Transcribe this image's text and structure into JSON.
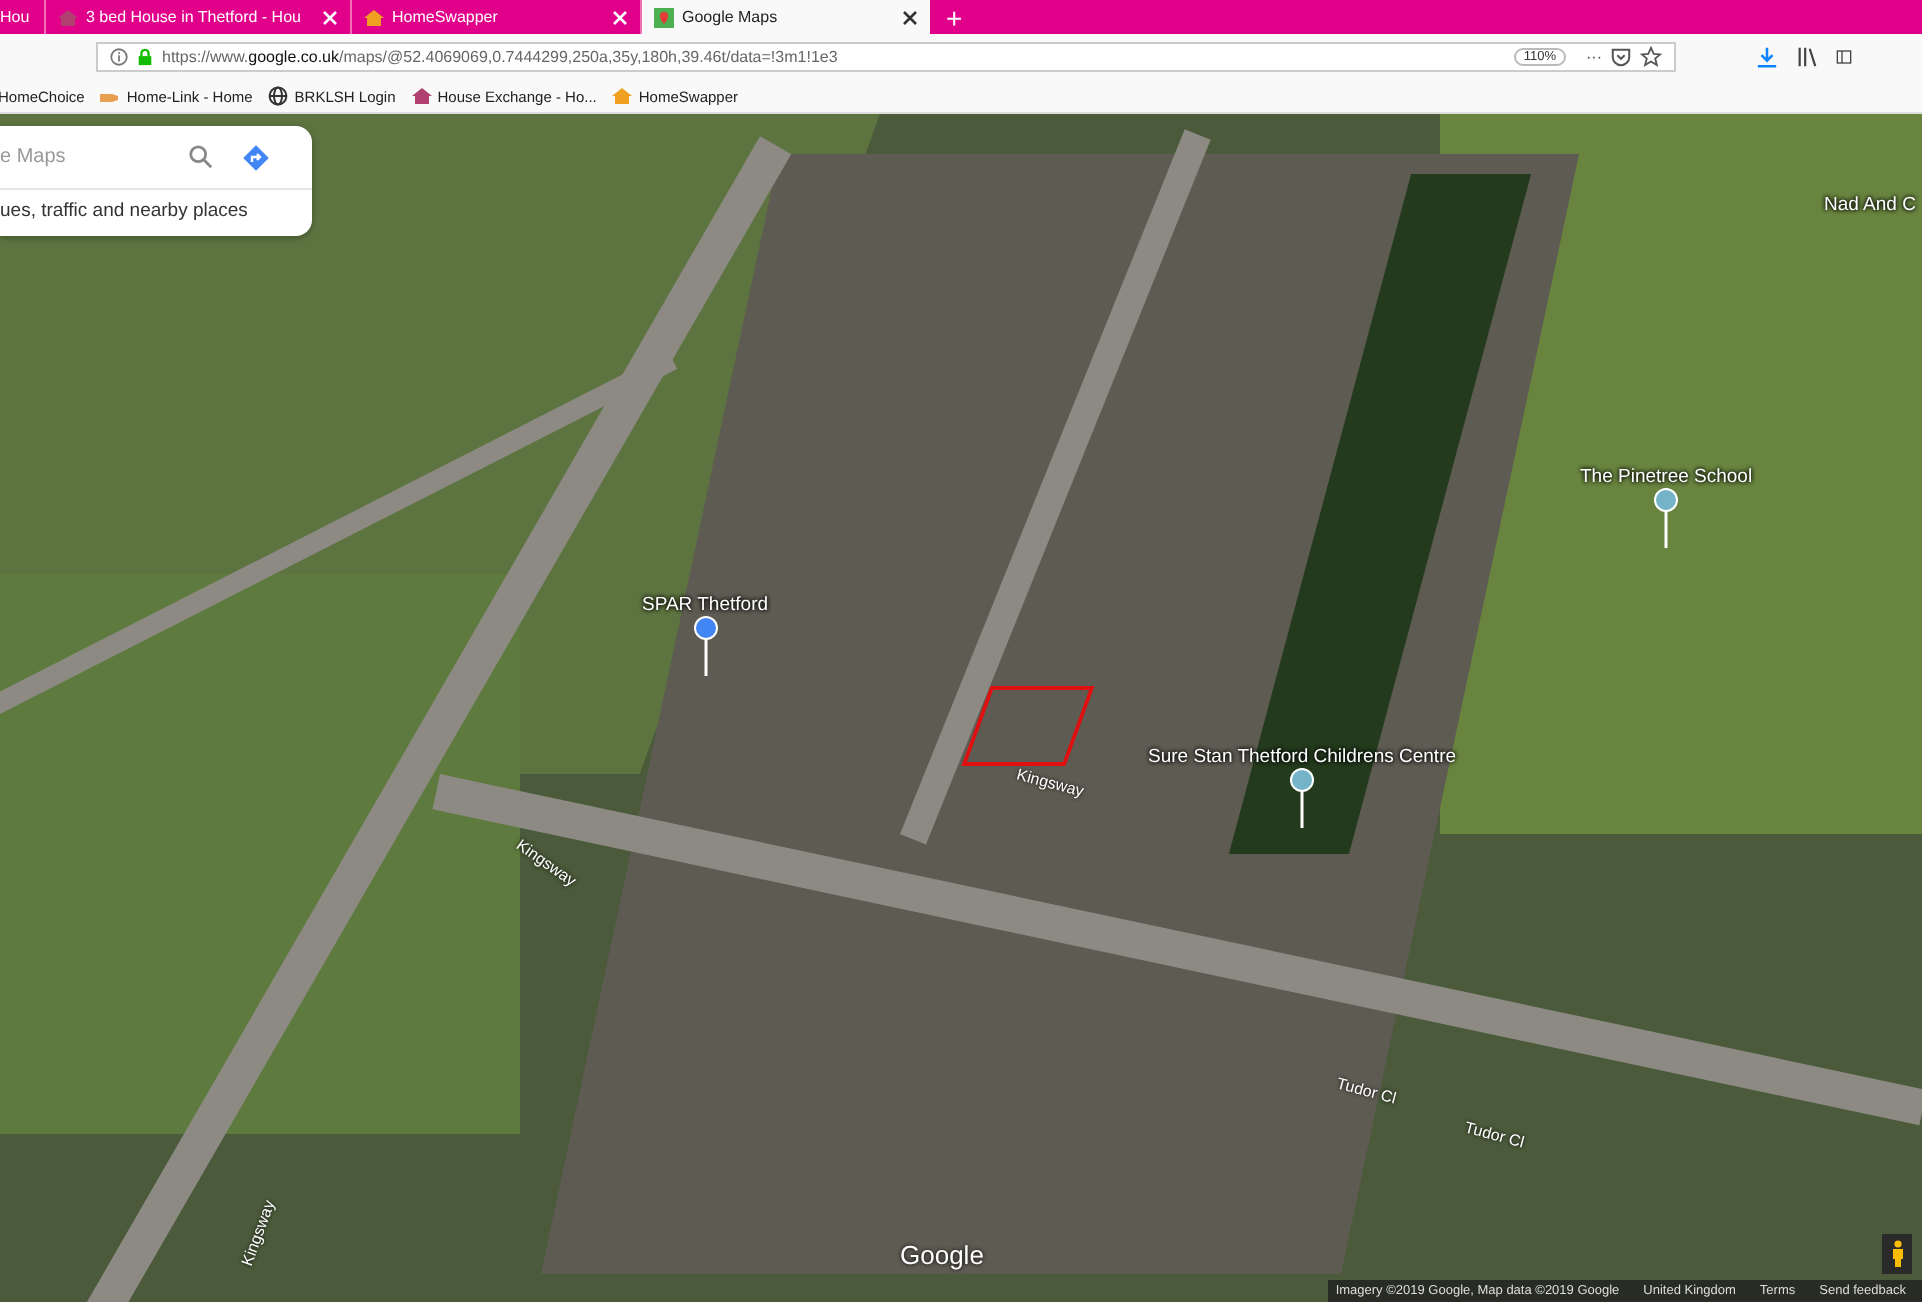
{
  "tabs": [
    {
      "title": "Hou",
      "selected": false
    },
    {
      "title": "3 bed House in Thetford - Hou",
      "selected": false
    },
    {
      "title": "HomeSwapper",
      "selected": false
    },
    {
      "title": "Google Maps",
      "selected": true
    }
  ],
  "new_tab": "+",
  "address_bar": {
    "url_prefix": "https://www.",
    "url_domain": "google.co.uk",
    "url_rest": "/maps/@52.4069069,0.7444299,250a,35y,180h,39.46t/data=!3m1!1e3",
    "zoom": "110%",
    "more": "···"
  },
  "bookmarks": [
    {
      "label": "HomeChoice"
    },
    {
      "label": "Home-Link - Home"
    },
    {
      "label": "BRKLSH Login"
    },
    {
      "label": "House Exchange - Ho..."
    },
    {
      "label": "HomeSwapper"
    }
  ],
  "map": {
    "search": {
      "placeholder": "e Maps",
      "hint": "ues, traffic and nearby places"
    },
    "places": [
      {
        "name": "SPAR Thetford",
        "kind": "shop"
      },
      {
        "name": "The Pinetree School",
        "kind": "school"
      },
      {
        "name": "Sure Stan Thetford Childrens Centre",
        "kind": "school"
      },
      {
        "name": "Nad And C",
        "kind": "text"
      }
    ],
    "streets": [
      "Kingsway",
      "Kingsway",
      "Kingsway",
      "Tudor Cl",
      "Tudor Cl"
    ],
    "logo": "Google",
    "attribution": [
      "Imagery ©2019 Google, Map data ©2019 Google",
      "United Kingdom",
      "Terms",
      "Send feedback"
    ]
  }
}
